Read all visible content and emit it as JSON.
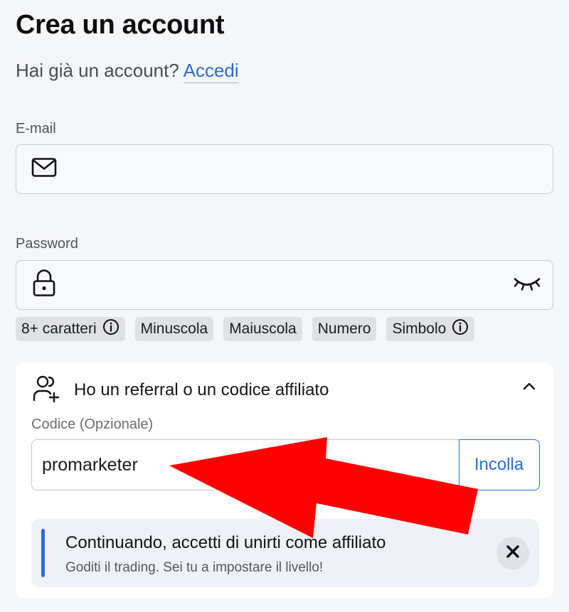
{
  "page": {
    "title": "Crea un account",
    "login_prompt": "Hai già un account?",
    "login_link": "Accedi"
  },
  "email": {
    "label": "E-mail",
    "value": "",
    "icon": "mail-icon"
  },
  "password": {
    "label": "Password",
    "value": "",
    "icon": "lock-icon",
    "toggle_icon": "eye-closed-icon",
    "requirements": [
      {
        "label": "8+ caratteri",
        "info": true
      },
      {
        "label": "Minuscola",
        "info": false
      },
      {
        "label": "Maiuscola",
        "info": false
      },
      {
        "label": "Numero",
        "info": false
      },
      {
        "label": "Simbolo",
        "info": true
      }
    ]
  },
  "referral": {
    "title": "Ho un referral o un codice affiliato",
    "code_label": "Codice (Opzionale)",
    "code_value": "promarketer",
    "paste_label": "Incolla",
    "notice_title": "Continuando, accetti di unirti come affiliato",
    "notice_sub": "Goditi il trading. Sei tu a impostare il livello!"
  },
  "colors": {
    "accent": "#2e6bd9",
    "annotation_arrow": "#ff0000",
    "chip_bg": "#dfe1e5",
    "page_bg": "#f5f6f8"
  }
}
